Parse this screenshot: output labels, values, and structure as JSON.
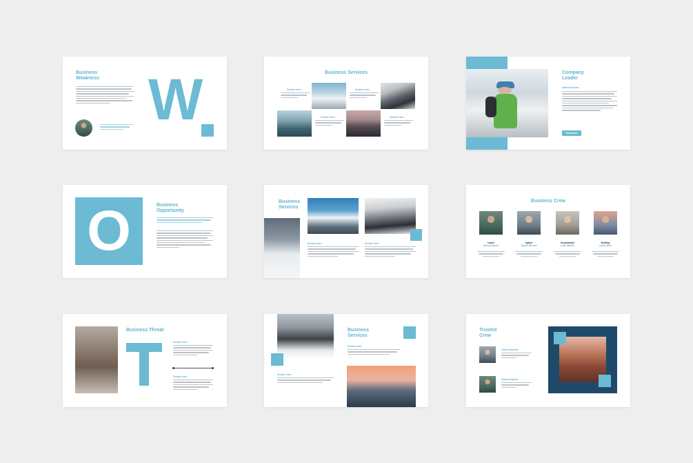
{
  "slides": {
    "weakness": {
      "title_line1": "Business",
      "title_line2": "Weakness",
      "letter": "W"
    },
    "services1": {
      "title": "Business Services",
      "section": "Section Here"
    },
    "leader": {
      "title_line1": "Company",
      "title_line2": "Leader",
      "name": "Dianna Dapeza",
      "button": "Read More"
    },
    "opportunity": {
      "title_line1": "Business",
      "title_line2": "Opportunity",
      "letter": "O"
    },
    "services2": {
      "title_line1": "Business",
      "title_line2": "Services",
      "section": "Section Here"
    },
    "crew": {
      "title": "Business Crew",
      "members": [
        {
          "role": "Leader",
          "name": "Dianna Dapeza"
        },
        {
          "role": "Lighter",
          "name": "Tyrone Bennett"
        },
        {
          "role": "Secondmator",
          "name": "Luish Warren"
        },
        {
          "role": "Working",
          "name": "Lennix Burs"
        }
      ]
    },
    "threat": {
      "title": "Business Threat",
      "letter": "T",
      "section": "Section Here"
    },
    "services3": {
      "title_line1": "Business",
      "title_line2": "Services",
      "section": "Section Here"
    },
    "trusted": {
      "title_line1": "Trusted",
      "title_line2": "Crew",
      "member1": "Tyrone Bennett",
      "member2": "Dianna Dapeza"
    }
  },
  "colors": {
    "accent": "#6cbad3",
    "background": "#eeeeef",
    "navy": "#1e4a6a"
  }
}
